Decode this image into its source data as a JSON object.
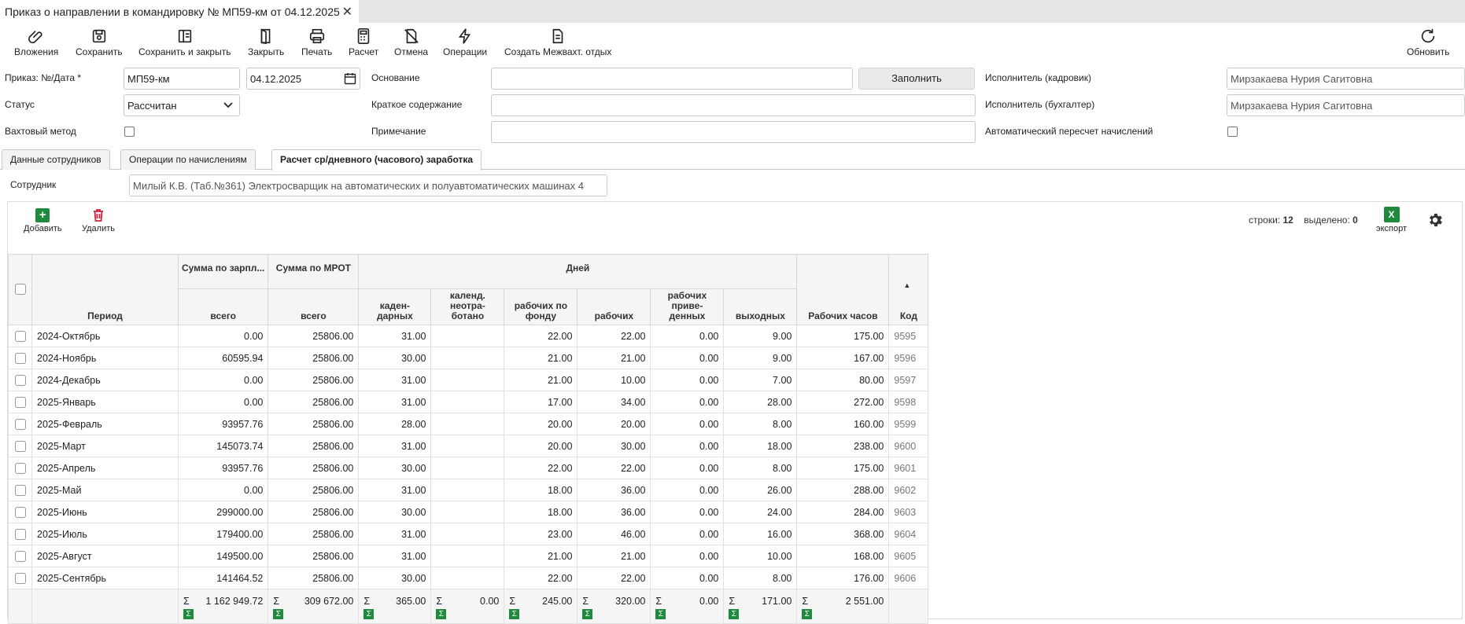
{
  "window": {
    "tab_title": "Приказ о направлении в командировку № МП59-км от 04.12.2025",
    "close_glyph": "✕"
  },
  "toolbar": {
    "attachments": "Вложения",
    "save": "Сохранить",
    "save_close": "Сохранить и закрыть",
    "close": "Закрыть",
    "print": "Печать",
    "calc": "Расчет",
    "cancel": "Отмена",
    "operations": "Операции",
    "create_rest": "Создать Межвахт. отдых",
    "refresh": "Обновить"
  },
  "form": {
    "order_label": "Приказ: №/Дата *",
    "order_number": "МП59-км",
    "order_date": "04.12.2025",
    "status_label": "Статус",
    "status_value": "Рассчитан",
    "shift_label": "Вахтовый метод",
    "basis_label": "Основание",
    "basis_value": "",
    "fill_button": "Заполнить",
    "summary_label": "Краткое содержание",
    "summary_value": "",
    "note_label": "Примечание",
    "note_value": "",
    "hr_label": "Исполнитель (кадровик)",
    "hr_value": "Мирзакаева Нурия Сагитовна",
    "acc_label": "Исполнитель (бухгалтер)",
    "acc_value": "Мирзакаева Нурия Сагитовна",
    "auto_label": "Автоматический пересчет начислений"
  },
  "tabs": [
    {
      "label": "Данные сотрудников"
    },
    {
      "label": "Операции по начислениям"
    },
    {
      "label": "Расчет ср/дневного (часового) заработка"
    }
  ],
  "panel": {
    "employee_label": "Сотрудник",
    "employee_value": "Милый К.В. (Таб.№361) Электросварщик на автоматических и полуавтоматических машинах 4"
  },
  "grid_toolbar": {
    "add": "Добавить",
    "delete": "Удалить",
    "rows_label": "строки:",
    "rows_count": "12",
    "selected_label": "выделено:",
    "selected_count": "0",
    "export": "экспорт",
    "export_icon_text": "X"
  },
  "columns": {
    "period": "Период",
    "salary_sum": "Сумма по зарпл...",
    "mrot_sum": "Сумма по МРОТ",
    "days": "Дней",
    "total": "всего",
    "cal_days": "каден-дарных",
    "cal_unworked": "календ. неотра-ботано",
    "work_fund": "рабочих по фонду",
    "work": "рабочих",
    "work_reduced": "рабочих приве-денных",
    "weekend": "выходных",
    "hours": "Рабочих часов",
    "code": "Код"
  },
  "rows": [
    {
      "period": "2024-Октябрь",
      "salary": "0.00",
      "mrot": "25806.00",
      "cal": "31.00",
      "unworked": "",
      "fund": "22.00",
      "work": "22.00",
      "reduced": "0.00",
      "weekend": "9.00",
      "hours": "175.00",
      "code": "9595"
    },
    {
      "period": "2024-Ноябрь",
      "salary": "60595.94",
      "mrot": "25806.00",
      "cal": "30.00",
      "unworked": "",
      "fund": "21.00",
      "work": "21.00",
      "reduced": "0.00",
      "weekend": "9.00",
      "hours": "167.00",
      "code": "9596"
    },
    {
      "period": "2024-Декабрь",
      "salary": "0.00",
      "mrot": "25806.00",
      "cal": "31.00",
      "unworked": "",
      "fund": "21.00",
      "work": "10.00",
      "reduced": "0.00",
      "weekend": "7.00",
      "hours": "80.00",
      "code": "9597"
    },
    {
      "period": "2025-Январь",
      "salary": "0.00",
      "mrot": "25806.00",
      "cal": "31.00",
      "unworked": "",
      "fund": "17.00",
      "work": "34.00",
      "reduced": "0.00",
      "weekend": "28.00",
      "hours": "272.00",
      "code": "9598"
    },
    {
      "period": "2025-Февраль",
      "salary": "93957.76",
      "mrot": "25806.00",
      "cal": "28.00",
      "unworked": "",
      "fund": "20.00",
      "work": "20.00",
      "reduced": "0.00",
      "weekend": "8.00",
      "hours": "160.00",
      "code": "9599"
    },
    {
      "period": "2025-Март",
      "salary": "145073.74",
      "mrot": "25806.00",
      "cal": "31.00",
      "unworked": "",
      "fund": "20.00",
      "work": "30.00",
      "reduced": "0.00",
      "weekend": "18.00",
      "hours": "238.00",
      "code": "9600"
    },
    {
      "period": "2025-Апрель",
      "salary": "93957.76",
      "mrot": "25806.00",
      "cal": "30.00",
      "unworked": "",
      "fund": "22.00",
      "work": "22.00",
      "reduced": "0.00",
      "weekend": "8.00",
      "hours": "175.00",
      "code": "9601"
    },
    {
      "period": "2025-Май",
      "salary": "0.00",
      "mrot": "25806.00",
      "cal": "31.00",
      "unworked": "",
      "fund": "18.00",
      "work": "36.00",
      "reduced": "0.00",
      "weekend": "26.00",
      "hours": "288.00",
      "code": "9602"
    },
    {
      "period": "2025-Июнь",
      "salary": "299000.00",
      "mrot": "25806.00",
      "cal": "30.00",
      "unworked": "",
      "fund": "18.00",
      "work": "36.00",
      "reduced": "0.00",
      "weekend": "24.00",
      "hours": "284.00",
      "code": "9603"
    },
    {
      "period": "2025-Июль",
      "salary": "179400.00",
      "mrot": "25806.00",
      "cal": "31.00",
      "unworked": "",
      "fund": "23.00",
      "work": "46.00",
      "reduced": "0.00",
      "weekend": "16.00",
      "hours": "368.00",
      "code": "9604"
    },
    {
      "period": "2025-Август",
      "salary": "149500.00",
      "mrot": "25806.00",
      "cal": "31.00",
      "unworked": "",
      "fund": "21.00",
      "work": "21.00",
      "reduced": "0.00",
      "weekend": "10.00",
      "hours": "168.00",
      "code": "9605"
    },
    {
      "period": "2025-Сентябрь",
      "salary": "141464.52",
      "mrot": "25806.00",
      "cal": "30.00",
      "unworked": "",
      "fund": "22.00",
      "work": "22.00",
      "reduced": "0.00",
      "weekend": "8.00",
      "hours": "176.00",
      "code": "9606"
    }
  ],
  "totals": {
    "sigma": "Σ",
    "salary": "1 162 949.72",
    "mrot": "309 672.00",
    "cal": "365.00",
    "unworked": "0.00",
    "fund": "245.00",
    "work": "320.00",
    "reduced": "0.00",
    "weekend": "171.00",
    "hours": "2 551.00"
  },
  "colors": {
    "accent_green": "#1e8a3c",
    "delete_red": "#d0203a"
  }
}
